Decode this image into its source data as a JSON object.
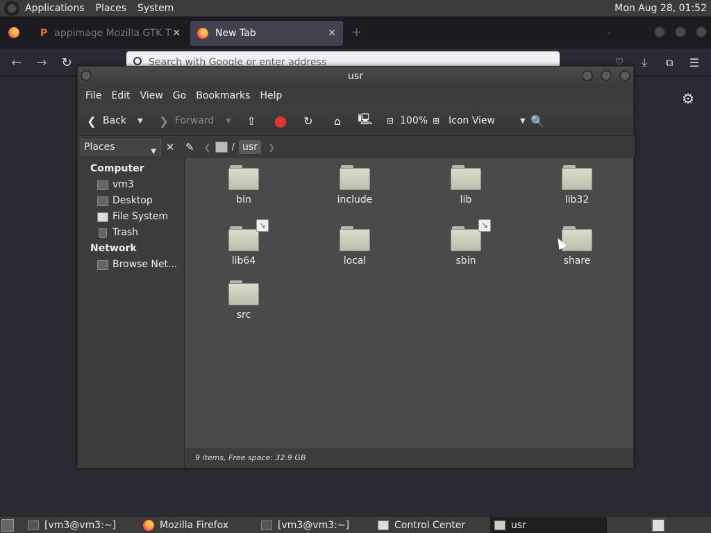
{
  "top_panel": {
    "menus": [
      "Applications",
      "Places",
      "System"
    ],
    "clock": "Mon Aug 28, 01:52"
  },
  "browser": {
    "tabs": [
      {
        "title": "appimage Mozilla GTK Th",
        "active": false
      },
      {
        "title": "New Tab",
        "active": true
      }
    ],
    "url_placeholder": "Search with Google or enter address"
  },
  "file_manager": {
    "window_title": "usr",
    "menubar": [
      "File",
      "Edit",
      "View",
      "Go",
      "Bookmarks",
      "Help"
    ],
    "toolbar": {
      "back_label": "Back",
      "forward_label": "Forward",
      "zoom_level": "100%",
      "view_mode": "Icon View"
    },
    "location": {
      "sidebar_selector": "Places",
      "separator": "/",
      "current_crumb": "usr"
    },
    "sidebar": {
      "computer_heading": "Computer",
      "computer_items": [
        "vm3",
        "Desktop",
        "File System",
        "Trash"
      ],
      "network_heading": "Network",
      "network_items": [
        "Browse Net..."
      ]
    },
    "files": [
      {
        "name": "bin",
        "symlink": false
      },
      {
        "name": "include",
        "symlink": false
      },
      {
        "name": "lib",
        "symlink": false
      },
      {
        "name": "lib32",
        "symlink": false
      },
      {
        "name": "lib64",
        "symlink": true
      },
      {
        "name": "local",
        "symlink": false
      },
      {
        "name": "sbin",
        "symlink": true
      },
      {
        "name": "share",
        "symlink": false
      },
      {
        "name": "src",
        "symlink": false
      }
    ],
    "status": "9 items, Free space: 32.9 GB"
  },
  "taskbar": {
    "tasks": [
      {
        "label": "[vm3@vm3:~]",
        "active": false
      },
      {
        "label": "Mozilla Firefox",
        "active": false
      },
      {
        "label": "[vm3@vm3:~]",
        "active": false
      },
      {
        "label": "Control Center",
        "active": false
      },
      {
        "label": "usr",
        "active": true
      }
    ]
  }
}
